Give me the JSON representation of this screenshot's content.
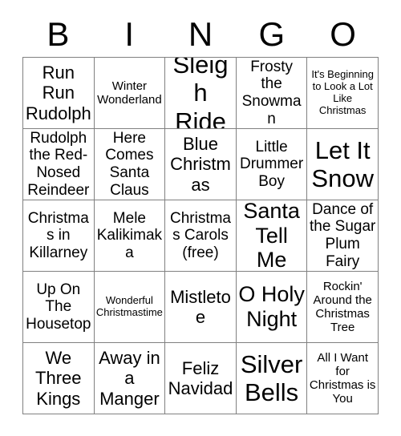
{
  "card": {
    "header_letters": [
      "B",
      "I",
      "N",
      "G",
      "O"
    ],
    "grid": [
      [
        {
          "text": "Run Run Rudolph",
          "size": "l"
        },
        {
          "text": "Winter Wonderland",
          "size": "s"
        },
        {
          "text": "Sleigh Ride",
          "size": "xxl"
        },
        {
          "text": "Frosty the Snowman",
          "size": "m"
        },
        {
          "text": "It's Beginning to Look a Lot Like Christmas",
          "size": "xs"
        }
      ],
      [
        {
          "text": "Rudolph the Red-Nosed Reindeer",
          "size": "m"
        },
        {
          "text": "Here Comes Santa Claus",
          "size": "m"
        },
        {
          "text": "Blue Christmas",
          "size": "l"
        },
        {
          "text": "Little Drummer Boy",
          "size": "m"
        },
        {
          "text": "Let It Snow",
          "size": "xxl"
        }
      ],
      [
        {
          "text": "Christmas in Killarney",
          "size": "m"
        },
        {
          "text": "Mele Kalikimaka",
          "size": "m"
        },
        {
          "text": "Christmas Carols (free)",
          "size": "m"
        },
        {
          "text": "Santa Tell Me",
          "size": "xl"
        },
        {
          "text": "Dance of the Sugar Plum Fairy",
          "size": "m"
        }
      ],
      [
        {
          "text": "Up On The Housetop",
          "size": "m"
        },
        {
          "text": "Wonderful Christmastime",
          "size": "xs"
        },
        {
          "text": "Mistletoe",
          "size": "l"
        },
        {
          "text": "O Holy Night",
          "size": "xl"
        },
        {
          "text": "Rockin' Around the Christmas Tree",
          "size": "s"
        }
      ],
      [
        {
          "text": "We Three Kings",
          "size": "l"
        },
        {
          "text": "Away in a Manger",
          "size": "l"
        },
        {
          "text": "Feliz Navidad",
          "size": "l"
        },
        {
          "text": "Silver Bells",
          "size": "xxl"
        },
        {
          "text": "All I Want for Christmas is You",
          "size": "s"
        }
      ]
    ]
  },
  "colors": {
    "border": "#808080",
    "text": "#000000",
    "background": "#ffffff"
  }
}
